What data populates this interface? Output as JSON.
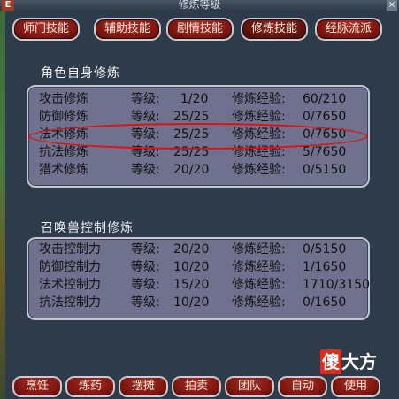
{
  "window": {
    "title": "修炼等级",
    "close": "×",
    "corner": "E"
  },
  "tabs": [
    "师门技能",
    "辅助技能",
    "剧情技能",
    "修炼技能",
    "经脉流派"
  ],
  "active_tab": 3,
  "self_section": {
    "title": "角色自身修炼",
    "rows": [
      {
        "name": "攻击修炼",
        "level_label": "等级:",
        "level": "1/20",
        "exp_label": "修炼经验:",
        "exp": "60/210"
      },
      {
        "name": "防御修炼",
        "level_label": "等级:",
        "level": "25/25",
        "exp_label": "修炼经验:",
        "exp": "0/7650"
      },
      {
        "name": "法术修炼",
        "level_label": "等级:",
        "level": "25/25",
        "exp_label": "修炼经验:",
        "exp": "0/7650"
      },
      {
        "name": "抗法修炼",
        "level_label": "等级:",
        "level": "25/25",
        "exp_label": "修炼经验:",
        "exp": "5/7650"
      },
      {
        "name": "猎术修炼",
        "level_label": "等级:",
        "level": "20/20",
        "exp_label": "修炼经验:",
        "exp": "0/5150"
      }
    ]
  },
  "pet_section": {
    "title": "召唤兽控制修炼",
    "rows": [
      {
        "name": "攻击控制力",
        "level_label": "等级:",
        "level": "20/20",
        "exp_label": "修炼经验:",
        "exp": "0/5150"
      },
      {
        "name": "防御控制力",
        "level_label": "等级:",
        "level": "10/20",
        "exp_label": "修炼经验:",
        "exp": "1/1650"
      },
      {
        "name": "法术控制力",
        "level_label": "等级:",
        "level": "15/20",
        "exp_label": "修炼经验:",
        "exp": "1710/3150"
      },
      {
        "name": "抗法控制力",
        "level_label": "等级:",
        "level": "10/20",
        "exp_label": "修炼经验:",
        "exp": "0/1650"
      }
    ]
  },
  "bottom_buttons": [
    "烹饪",
    "炼药",
    "摆摊",
    "拍卖",
    "团队",
    "自动",
    "使用"
  ],
  "watermark": {
    "box": "傻",
    "rest": "大方"
  },
  "colors": {
    "tab_red": "#7a1510",
    "panel": "#6f718e",
    "highlight": "#e01010"
  }
}
